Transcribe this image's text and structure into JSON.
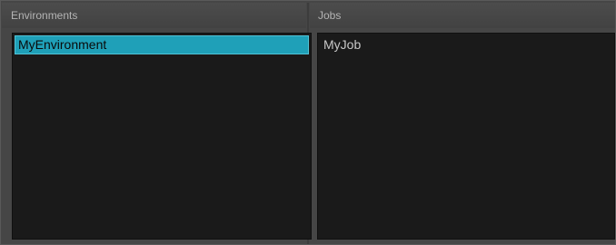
{
  "environments": {
    "header": "Environments",
    "items": [
      {
        "label": "MyEnvironment",
        "selected": true
      }
    ]
  },
  "jobs": {
    "header": "Jobs",
    "items": [
      {
        "label": "MyJob",
        "selected": false
      }
    ]
  },
  "colors": {
    "selection": "#1fa0b8",
    "list_background": "#1a1a1a",
    "panel_background": "#464646",
    "header_text": "#b4b4b4",
    "item_text": "#c8c8c8"
  }
}
